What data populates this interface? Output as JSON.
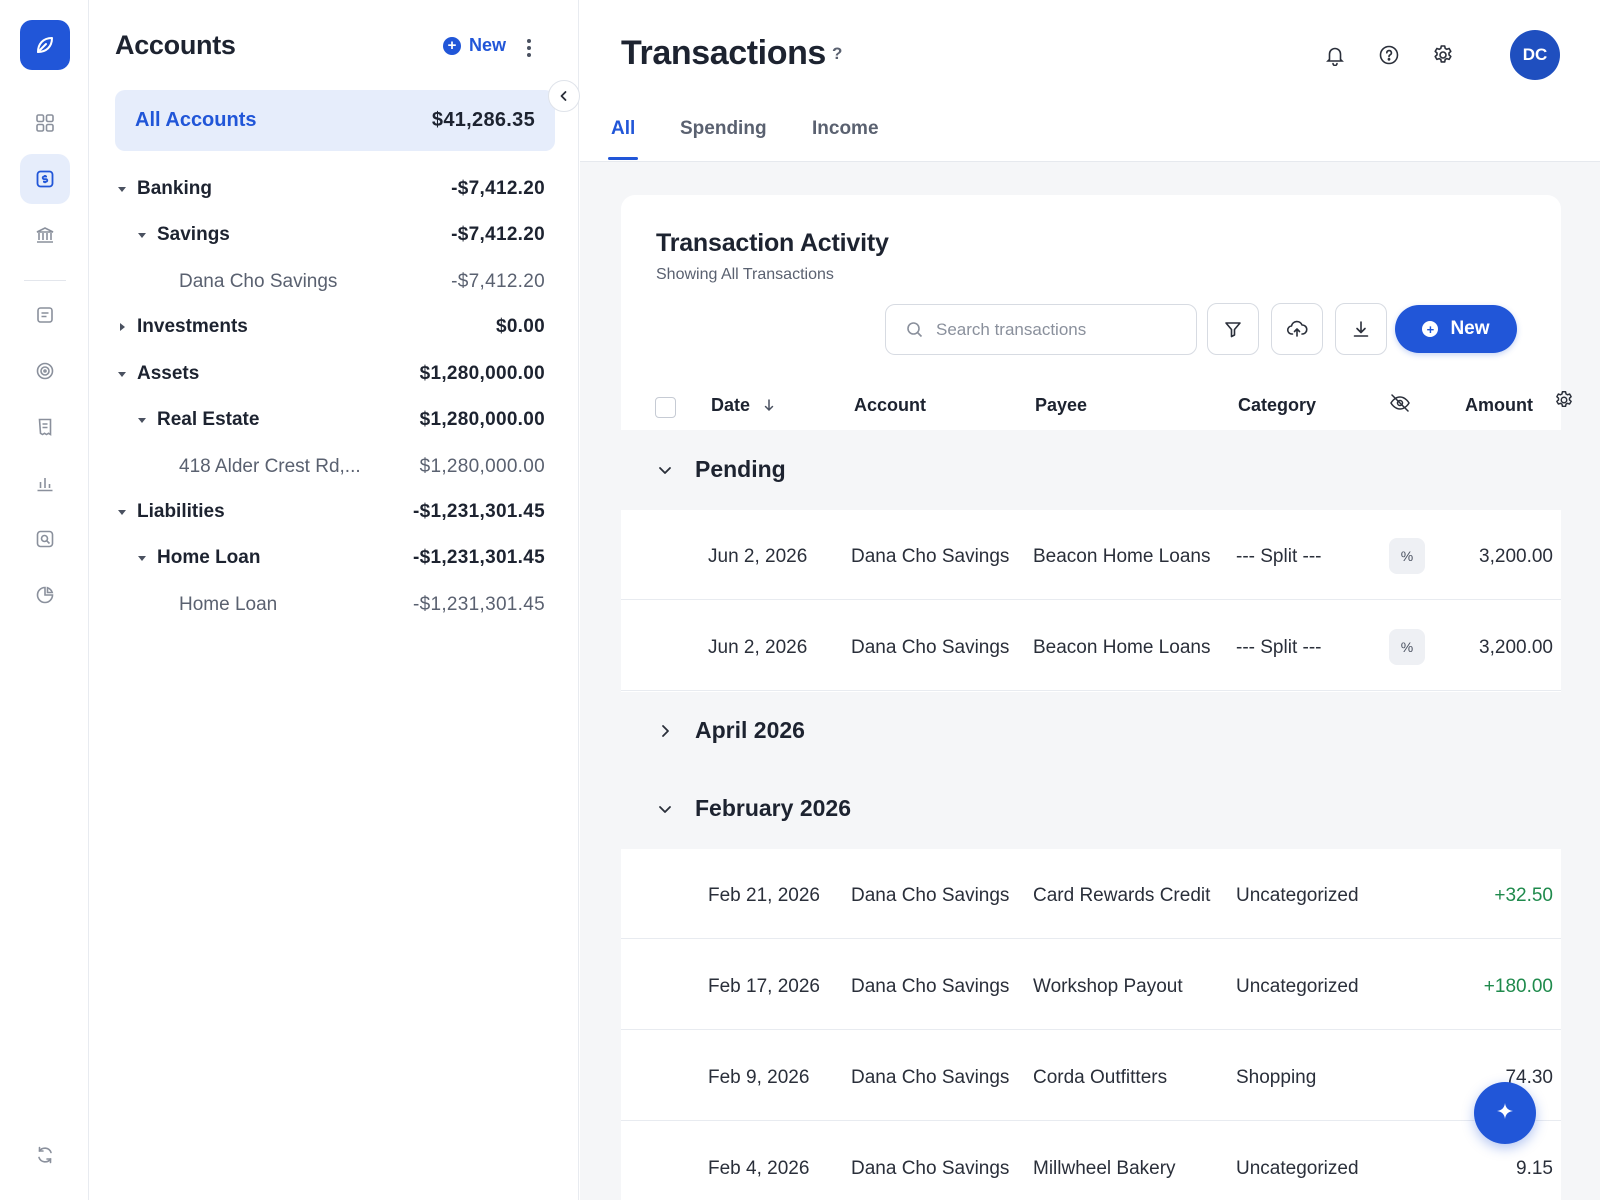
{
  "accounts_panel": {
    "title": "Accounts",
    "new_label": "New",
    "all_accounts": {
      "label": "All Accounts",
      "amount": "$41,286.35"
    },
    "tree": [
      {
        "name": "Banking",
        "amount": "-$7,412.20",
        "level": 0,
        "expanded": true
      },
      {
        "name": "Savings",
        "amount": "-$7,412.20",
        "level": 1,
        "expanded": true
      },
      {
        "name": "Dana Cho Savings",
        "amount": "-$7,412.20",
        "level": 2
      },
      {
        "name": "Investments",
        "amount": "$0.00",
        "level": 0,
        "expanded": false
      },
      {
        "name": "Assets",
        "amount": "$1,280,000.00",
        "level": 0,
        "expanded": true
      },
      {
        "name": "Real Estate",
        "amount": "$1,280,000.00",
        "level": 1,
        "expanded": true
      },
      {
        "name": "418 Alder Crest Rd,...",
        "amount": "$1,280,000.00",
        "level": 2
      },
      {
        "name": "Liabilities",
        "amount": "-$1,231,301.45",
        "level": 0,
        "expanded": true
      },
      {
        "name": "Home Loan",
        "amount": "-$1,231,301.45",
        "level": 1,
        "expanded": true
      },
      {
        "name": "Home Loan",
        "amount": "-$1,231,301.45",
        "level": 2
      }
    ]
  },
  "header": {
    "title": "Transactions",
    "help": "?",
    "avatar_initials": "DC",
    "tabs": [
      {
        "label": "All",
        "active": true
      },
      {
        "label": "Spending",
        "active": false
      },
      {
        "label": "Income",
        "active": false
      }
    ]
  },
  "activity": {
    "title": "Transaction Activity",
    "subtitle": "Showing All Transactions",
    "search_placeholder": "Search transactions",
    "new_label": "New",
    "columns": {
      "date": "Date",
      "account": "Account",
      "payee": "Payee",
      "category": "Category",
      "amount": "Amount"
    },
    "groups": [
      {
        "label": "Pending",
        "expanded": true,
        "rows": [
          {
            "date": "Jun 2, 2026",
            "account": "Dana Cho Savings",
            "payee": "Beacon Home Loans",
            "category": "--- Split ---",
            "split": true,
            "amount": "3,200.00",
            "positive": false
          },
          {
            "date": "Jun 2, 2026",
            "account": "Dana Cho Savings",
            "payee": "Beacon Home Loans",
            "category": "--- Split ---",
            "split": true,
            "amount": "3,200.00",
            "positive": false
          }
        ]
      },
      {
        "label": "April 2026",
        "expanded": false,
        "rows": []
      },
      {
        "label": "February 2026",
        "expanded": true,
        "rows": [
          {
            "date": "Feb 21, 2026",
            "account": "Dana Cho Savings",
            "payee": "Card Rewards Credit",
            "category": "Uncategorized",
            "split": false,
            "amount": "+32.50",
            "positive": true
          },
          {
            "date": "Feb 17, 2026",
            "account": "Dana Cho Savings",
            "payee": "Workshop Payout",
            "category": "Uncategorized",
            "split": false,
            "amount": "+180.00",
            "positive": true
          },
          {
            "date": "Feb 9, 2026",
            "account": "Dana Cho Savings",
            "payee": "Corda Outfitters",
            "category": "Shopping",
            "split": false,
            "amount": "74.30",
            "positive": false
          },
          {
            "date": "Feb 4, 2026",
            "account": "Dana Cho Savings",
            "payee": "Millwheel Bakery",
            "category": "Uncategorized",
            "split": false,
            "amount": "9.15",
            "positive": false
          }
        ]
      }
    ]
  },
  "colors": {
    "accent": "#2156d8",
    "positive": "#1f8a4c",
    "active_bg": "#e6edfb"
  },
  "icons": {
    "rail": [
      "leaf-logo-icon",
      "dashboard-icon",
      "transactions-icon",
      "bank-icon",
      "notes-icon",
      "goals-icon",
      "receipt-icon",
      "bar-chart-icon",
      "search-report-icon",
      "pie-chart-icon",
      "sync-icon"
    ],
    "top": [
      "bell-icon",
      "help-circle-icon",
      "gear-icon"
    ],
    "toolbar": [
      "search-icon",
      "filter-icon",
      "upload-icon",
      "download-icon"
    ]
  }
}
